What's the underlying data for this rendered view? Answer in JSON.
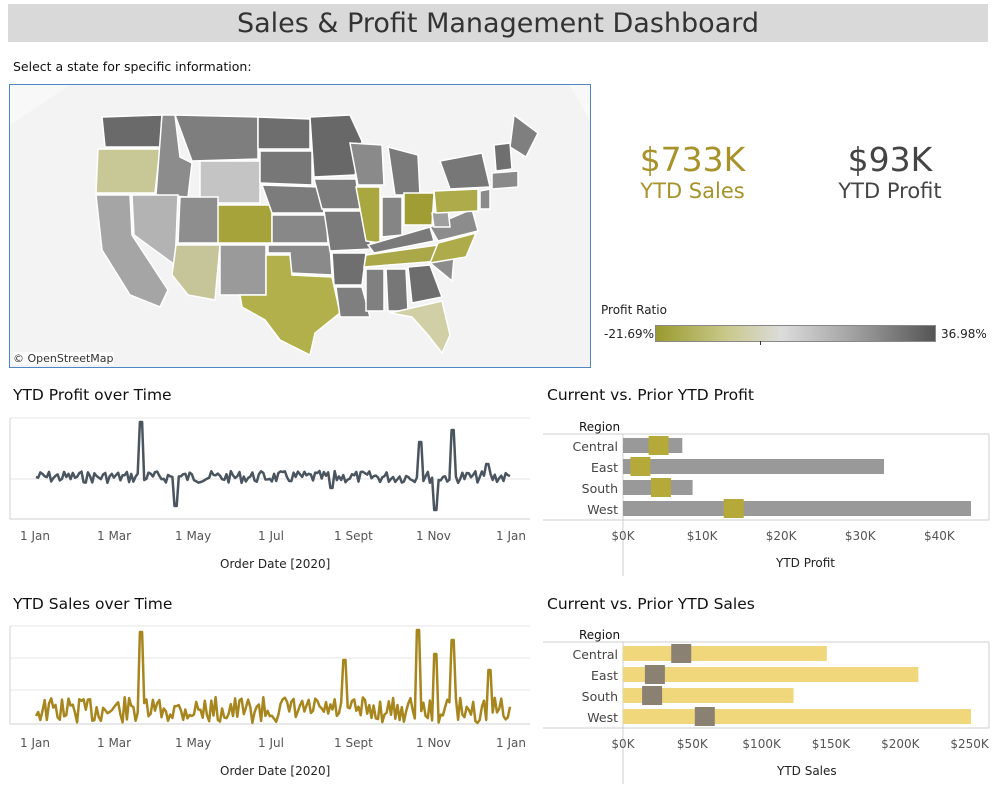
{
  "dashboard": {
    "title": "Sales & Profit Management Dashboard"
  },
  "map": {
    "prompt": "Select a state for specific information:",
    "credit": "© OpenStreetMap"
  },
  "kpis": {
    "sales": {
      "value": "$733K",
      "label": "YTD Sales",
      "color": "#a8922a"
    },
    "profit": {
      "value": "$93K",
      "label": "YTD Profit",
      "color": "#444444"
    }
  },
  "legend": {
    "title": "Profit Ratio",
    "min": "-21.69%",
    "max": "36.98%"
  },
  "profit_time": {
    "title": "YTD Profit over Time",
    "x_ticks": [
      "1 Jan",
      "1 Mar",
      "1 May",
      "1 Jul",
      "1 Sept",
      "1 Nov",
      "1 Jan"
    ],
    "x_title": "Order Date [2020]",
    "color": "#4a5560"
  },
  "sales_time": {
    "title": "YTD Sales over Time",
    "x_ticks": [
      "1 Jan",
      "1 Mar",
      "1 May",
      "1 Jul",
      "1 Sept",
      "1 Nov",
      "1 Jan"
    ],
    "x_title": "Order Date [2020]",
    "color": "#a8861e"
  },
  "profit_bar": {
    "title": "Current vs. Prior YTD Profit",
    "region_header": "Region",
    "regions": [
      "Central",
      "East",
      "South",
      "West"
    ],
    "current": [
      7500,
      33000,
      8800,
      44000
    ],
    "prior": [
      4500,
      2200,
      4800,
      14000
    ],
    "x_ticks": [
      "$0K",
      "$10K",
      "$20K",
      "$30K",
      "$40K"
    ],
    "x_tick_values": [
      0,
      10000,
      20000,
      30000,
      40000
    ],
    "x_max": 44000,
    "x_title": "YTD Profit",
    "bar_color": "#999999",
    "marker_color": "#b5a93a"
  },
  "sales_bar": {
    "title": "Current vs. Prior YTD Sales",
    "region_header": "Region",
    "regions": [
      "Central",
      "East",
      "South",
      "West"
    ],
    "current": [
      147000,
      213000,
      123000,
      251000
    ],
    "prior": [
      42000,
      23000,
      21000,
      59000
    ],
    "x_ticks": [
      "$0K",
      "$50K",
      "$100K",
      "$150K",
      "$200K",
      "$250K"
    ],
    "x_tick_values": [
      0,
      50000,
      100000,
      150000,
      200000,
      250000
    ],
    "x_max": 251000,
    "x_title": "YTD Sales",
    "bar_color": "#f0d77c",
    "marker_color": "#8a8172"
  },
  "chart_data": [
    {
      "type": "bar",
      "title": "Current vs. Prior YTD Profit",
      "categories": [
        "Central",
        "East",
        "South",
        "West"
      ],
      "series": [
        {
          "values": [
            7500,
            33000,
            8800,
            44000
          ]
        },
        {
          "values": [
            4500,
            2200,
            4800,
            14000
          ]
        }
      ],
      "xlabel": "YTD Profit",
      "ylabel": "Region",
      "xlim": [
        0,
        44000
      ]
    },
    {
      "type": "bar",
      "title": "Current vs. Prior YTD Sales",
      "categories": [
        "Central",
        "East",
        "South",
        "West"
      ],
      "series": [
        {
          "values": [
            147000,
            213000,
            123000,
            251000
          ]
        },
        {
          "values": [
            42000,
            23000,
            21000,
            59000
          ]
        }
      ],
      "xlabel": "YTD Sales",
      "ylabel": "Region",
      "xlim": [
        0,
        251000
      ]
    },
    {
      "type": "line",
      "title": "YTD Profit over Time",
      "xlabel": "Order Date [2020]",
      "x": [
        "1 Jan",
        "1 Mar",
        "1 May",
        "1 Jul",
        "1 Sept",
        "1 Nov",
        "1 Jan"
      ]
    },
    {
      "type": "line",
      "title": "YTD Sales over Time",
      "xlabel": "Order Date [2020]",
      "x": [
        "1 Jan",
        "1 Mar",
        "1 May",
        "1 Jul",
        "1 Sept",
        "1 Nov",
        "1 Jan"
      ]
    }
  ]
}
